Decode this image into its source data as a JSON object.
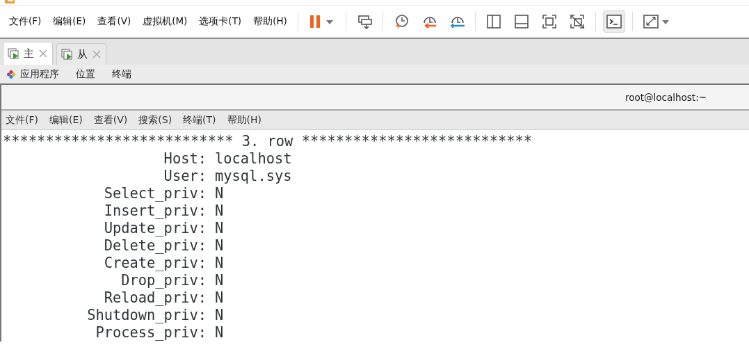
{
  "menu": [
    "文件(F)",
    "编辑(E)",
    "查看(V)",
    "虚拟机(M)",
    "选项卡(T)",
    "帮助(H)"
  ],
  "toolbar": [
    {
      "selected": false
    },
    {
      "selected": false
    },
    {
      "selected": false
    },
    {
      "selected": false
    },
    {
      "selected": false
    },
    {
      "selected": false
    },
    {
      "selected": false
    },
    {
      "selected": false
    },
    {
      "selected": false
    },
    {
      "selected": true
    },
    {
      "selected": false
    }
  ],
  "tabs": [
    {
      "label": "主",
      "selected": true
    },
    {
      "label": "从",
      "selected": false
    }
  ],
  "guest_panel": [
    "应用程序",
    "位置",
    "终端"
  ],
  "terminal": {
    "title": "root@localhost:~",
    "menu": [
      "文件(F)",
      "编辑(E)",
      "查看(V)",
      "搜索(S)",
      "终端(T)",
      "帮助(H)"
    ],
    "header": "*************************** 3. row ***************************",
    "fields": [
      {
        "name": "Host:",
        "value": "localhost"
      },
      {
        "name": "User:",
        "value": "mysql.sys"
      },
      {
        "name": "Select_priv:",
        "value": "N"
      },
      {
        "name": "Insert_priv:",
        "value": "N"
      },
      {
        "name": "Update_priv:",
        "value": "N"
      },
      {
        "name": "Delete_priv:",
        "value": "N"
      },
      {
        "name": "Create_priv:",
        "value": "N"
      },
      {
        "name": "Drop_priv:",
        "value": "N"
      },
      {
        "name": "Reload_priv:",
        "value": "N"
      },
      {
        "name": "Shutdown_priv:",
        "value": "N"
      },
      {
        "name": "Process_priv:",
        "value": "N"
      }
    ]
  }
}
